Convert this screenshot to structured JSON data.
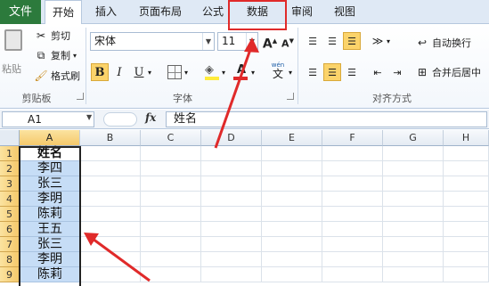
{
  "tabs": {
    "file": "文件",
    "items": [
      "开始",
      "插入",
      "页面布局",
      "公式",
      "数据",
      "审阅",
      "视图"
    ],
    "active": "开始"
  },
  "clipboard": {
    "paste": "粘贴",
    "cut": "剪切",
    "copy": "复制",
    "format_painter": "格式刷",
    "group_label": "剪贴板"
  },
  "font": {
    "name": "宋体",
    "size": "11",
    "grow": "A",
    "shrink": "A",
    "bold": "B",
    "italic": "I",
    "underline": "U",
    "font_color_letter": "A",
    "phonetic": "wén",
    "group_label": "字体",
    "highlight_color": "#fbd36a"
  },
  "alignment": {
    "wrap_text": "自动换行",
    "merge_center": "合并后居中",
    "group_label": "对齐方式"
  },
  "formula_bar": {
    "name_box": "A1",
    "fx": "fx",
    "content": "姓名"
  },
  "sheet": {
    "columns": [
      "A",
      "B",
      "C",
      "D",
      "E",
      "F",
      "G",
      "H"
    ],
    "rows": [
      "1",
      "2",
      "3",
      "4",
      "5",
      "6",
      "7",
      "8",
      "9"
    ],
    "column_a": [
      "姓名",
      "李四",
      "张三",
      "李明",
      "陈莉",
      "王五",
      "张三",
      "李明",
      "陈莉"
    ]
  },
  "annotation_color": "#e02a2a"
}
